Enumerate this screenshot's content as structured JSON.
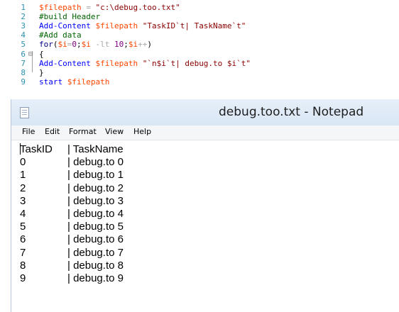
{
  "editor": {
    "lines": [
      {
        "n": "1",
        "tokens": [
          {
            "t": "$filepath",
            "c": "var"
          },
          {
            "t": " = ",
            "c": "op"
          },
          {
            "t": "\"c:\\debug.too.txt\"",
            "c": "str"
          }
        ]
      },
      {
        "n": "2",
        "tokens": [
          {
            "t": "#build Header",
            "c": "cmt"
          }
        ]
      },
      {
        "n": "3",
        "tokens": [
          {
            "t": "Add-Content",
            "c": "cmd"
          },
          {
            "t": " ",
            "c": "plain"
          },
          {
            "t": "$filepath",
            "c": "var"
          },
          {
            "t": " ",
            "c": "plain"
          },
          {
            "t": "\"TaskID`t| TaskName`t\"",
            "c": "str"
          }
        ]
      },
      {
        "n": "4",
        "tokens": [
          {
            "t": "#Add data",
            "c": "cmt"
          }
        ]
      },
      {
        "n": "5",
        "tokens": [
          {
            "t": "for",
            "c": "kw"
          },
          {
            "t": "(",
            "c": "plain"
          },
          {
            "t": "$i",
            "c": "var"
          },
          {
            "t": "=",
            "c": "op"
          },
          {
            "t": "0",
            "c": "num"
          },
          {
            "t": ";",
            "c": "plain"
          },
          {
            "t": "$i",
            "c": "var"
          },
          {
            "t": " -lt ",
            "c": "op"
          },
          {
            "t": "10",
            "c": "num"
          },
          {
            "t": ";",
            "c": "plain"
          },
          {
            "t": "$i",
            "c": "var"
          },
          {
            "t": "++",
            "c": "op"
          },
          {
            "t": ")",
            "c": "plain"
          }
        ]
      },
      {
        "n": "6",
        "fold": "⊟",
        "tokens": [
          {
            "t": "{",
            "c": "plain"
          }
        ]
      },
      {
        "n": "7",
        "tokens": [
          {
            "t": "Add-Content",
            "c": "cmd"
          },
          {
            "t": " ",
            "c": "plain"
          },
          {
            "t": "$filepath",
            "c": "var"
          },
          {
            "t": " ",
            "c": "plain"
          },
          {
            "t": "\"`n$i`t| debug.to $i`t\"",
            "c": "str"
          }
        ]
      },
      {
        "n": "8",
        "tokens": [
          {
            "t": "}",
            "c": "plain"
          }
        ]
      },
      {
        "n": "9",
        "tokens": [
          {
            "t": "start",
            "c": "cmd"
          },
          {
            "t": " ",
            "c": "plain"
          },
          {
            "t": "$filepath",
            "c": "var"
          }
        ]
      }
    ]
  },
  "notepad": {
    "icon": "notepad-icon",
    "title": "debug.too.txt - Notepad",
    "menu": [
      "File",
      "Edit",
      "Format",
      "View",
      "Help"
    ],
    "rows": [
      {
        "a": "TaskID",
        "b": "| TaskName"
      },
      {
        "a": "0",
        "b": "| debug.to 0"
      },
      {
        "a": "1",
        "b": "| debug.to 1"
      },
      {
        "a": "2",
        "b": "| debug.to 2"
      },
      {
        "a": "3",
        "b": "| debug.to 3"
      },
      {
        "a": "4",
        "b": "| debug.to 4"
      },
      {
        "a": "5",
        "b": "| debug.to 5"
      },
      {
        "a": "6",
        "b": "| debug.to 6"
      },
      {
        "a": "7",
        "b": "| debug.to 7"
      },
      {
        "a": "8",
        "b": "| debug.to 8"
      },
      {
        "a": "9",
        "b": "| debug.to 9"
      }
    ]
  }
}
